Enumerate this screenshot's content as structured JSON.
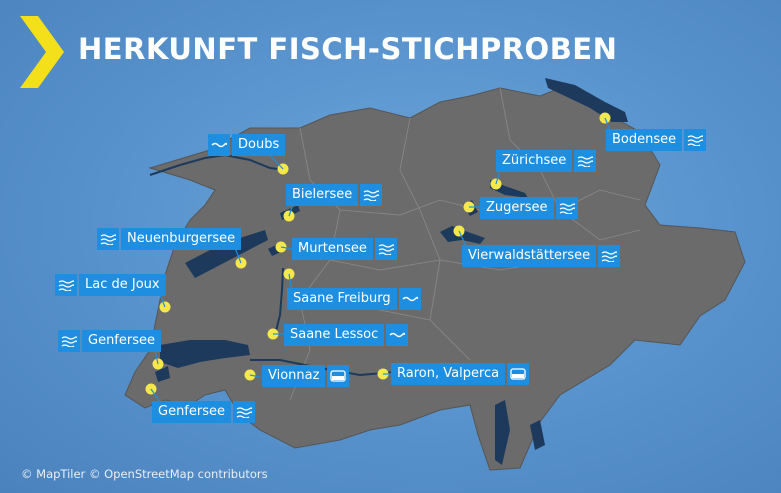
{
  "title": "HERKUNFT FISCH-STICHPROBEN",
  "credit": "© MapTiler © OpenStreetMap contributors",
  "colors": {
    "water": "#1d3a5c",
    "land": "#6d6d6d",
    "label": "#1e8fe0",
    "marker": "#f4e84a",
    "accent": "#f4e01a"
  },
  "locations": [
    {
      "name": "Doubs",
      "type": "river"
    },
    {
      "name": "Bielersee",
      "type": "lake"
    },
    {
      "name": "Neuenburgersee",
      "type": "lake"
    },
    {
      "name": "Murtensee",
      "type": "lake"
    },
    {
      "name": "Lac de Joux",
      "type": "lake"
    },
    {
      "name": "Saane Freiburg",
      "type": "river"
    },
    {
      "name": "Saane Lessoc",
      "type": "river"
    },
    {
      "name": "Genfersee",
      "type": "lake"
    },
    {
      "name": "Genfersee",
      "type": "lake"
    },
    {
      "name": "Vionnaz",
      "type": "farm"
    },
    {
      "name": "Raron, Valperca",
      "type": "farm"
    },
    {
      "name": "Zürichsee",
      "type": "lake"
    },
    {
      "name": "Zugersee",
      "type": "lake"
    },
    {
      "name": "Vierwaldstättersee",
      "type": "lake"
    },
    {
      "name": "Bodensee",
      "type": "lake"
    }
  ]
}
